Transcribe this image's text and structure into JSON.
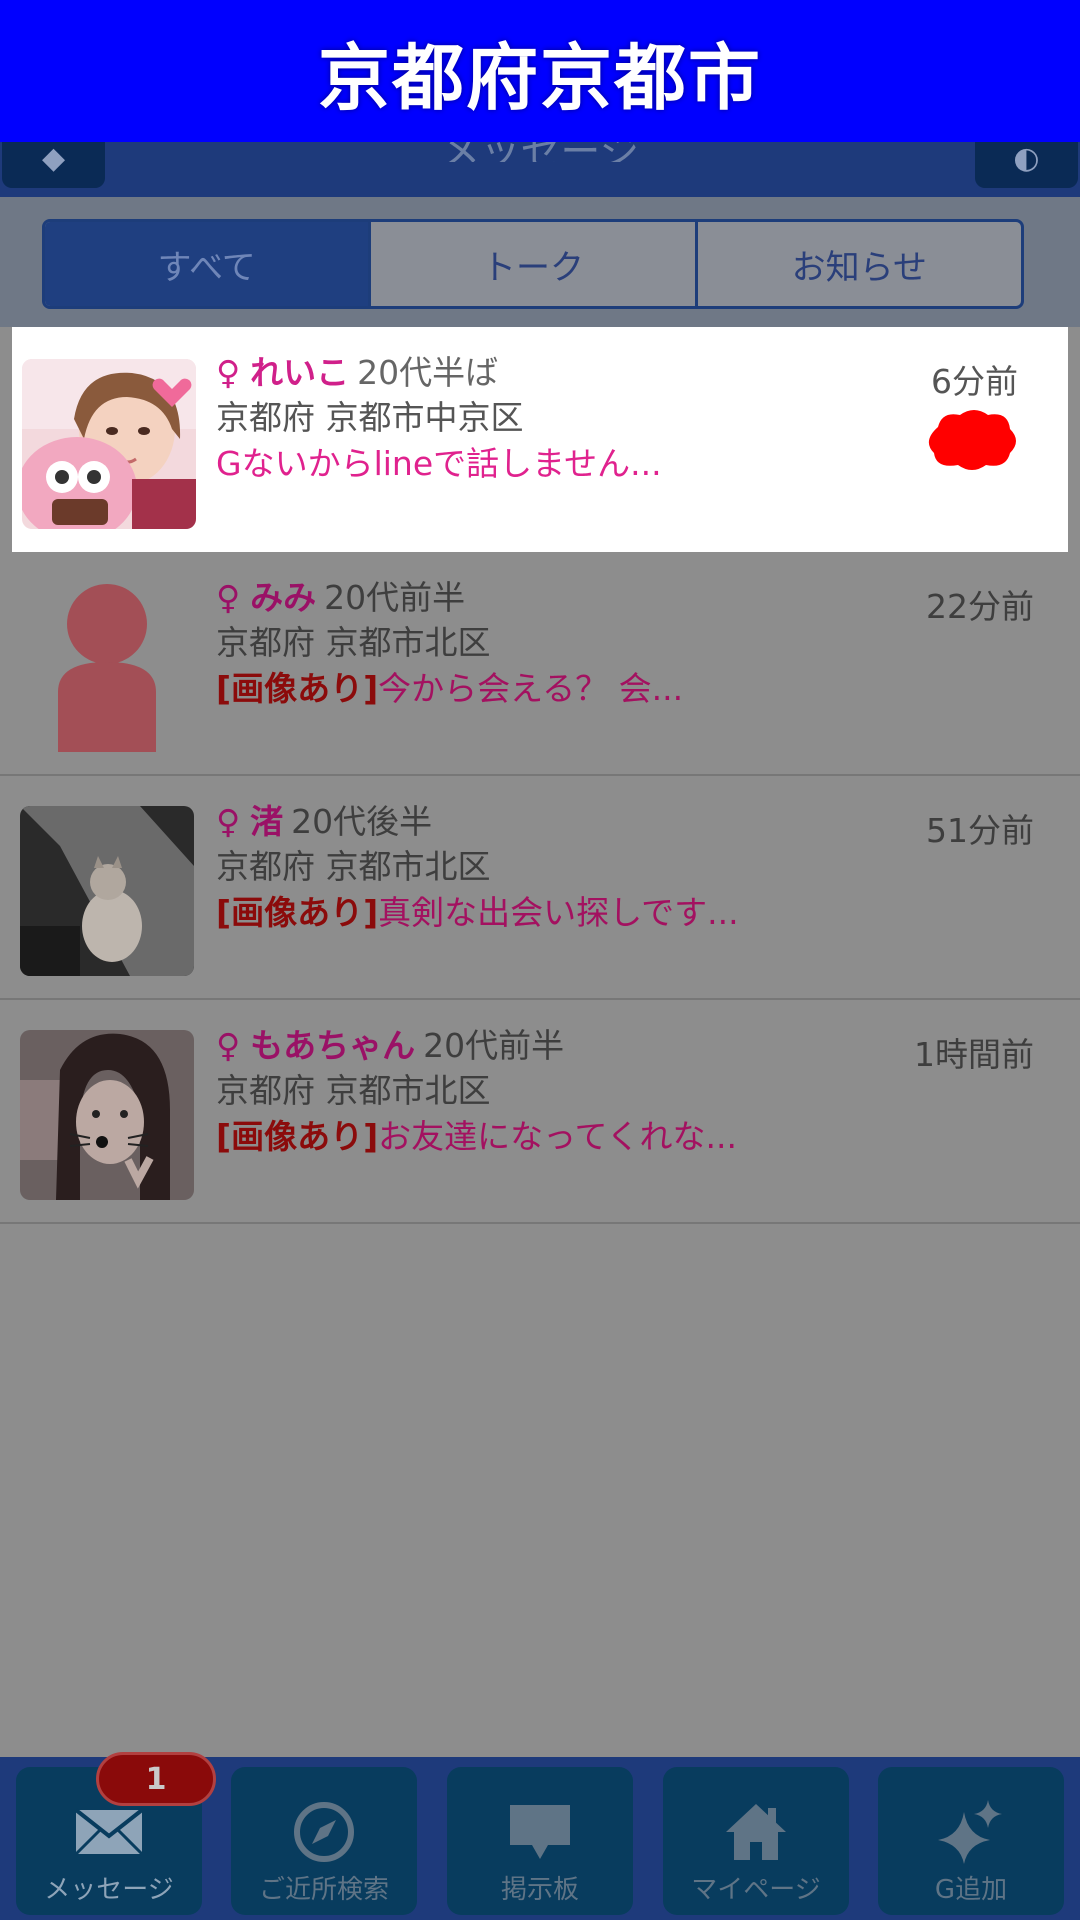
{
  "banner": {
    "title": "京都府京都市"
  },
  "header": {
    "title": "メッセージ"
  },
  "tabs": [
    {
      "label": "すべて"
    },
    {
      "label": "トーク"
    },
    {
      "label": "お知らせ"
    }
  ],
  "messages": [
    {
      "sex": "♀",
      "name": "れいこ",
      "age": "20代半ば",
      "location": "京都府 京都市中京区",
      "tag": "",
      "preview": "Gないからlineで話しません...",
      "time": "6分前"
    },
    {
      "sex": "♀",
      "name": "みみ",
      "age": "20代前半",
      "location": "京都府 京都市北区",
      "tag": "[画像あり]",
      "preview": "今から会える？ 会...",
      "time": "22分前"
    },
    {
      "sex": "♀",
      "name": "渚",
      "age": "20代後半",
      "location": "京都府 京都市北区",
      "tag": "[画像あり]",
      "preview": "真剣な出会い探しです...",
      "time": "51分前"
    },
    {
      "sex": "♀",
      "name": "もあちゃん",
      "age": "20代前半",
      "location": "京都府 京都市北区",
      "tag": "[画像あり]",
      "preview": "お友達になってくれな...",
      "time": "1時間前"
    }
  ],
  "bottom_nav": {
    "badge": "1",
    "items": [
      {
        "label": "メッセージ",
        "icon": "envelope-icon"
      },
      {
        "label": "ご近所検索",
        "icon": "compass-icon"
      },
      {
        "label": "掲示板",
        "icon": "speech-bubble-icon"
      },
      {
        "label": "マイページ",
        "icon": "home-icon"
      },
      {
        "label": "G追加",
        "icon": "sparkle-icon"
      }
    ]
  },
  "colors": {
    "banner": "#0000ff",
    "accent_pink": "#e0228e",
    "nav_background": "#1e3a7b"
  }
}
